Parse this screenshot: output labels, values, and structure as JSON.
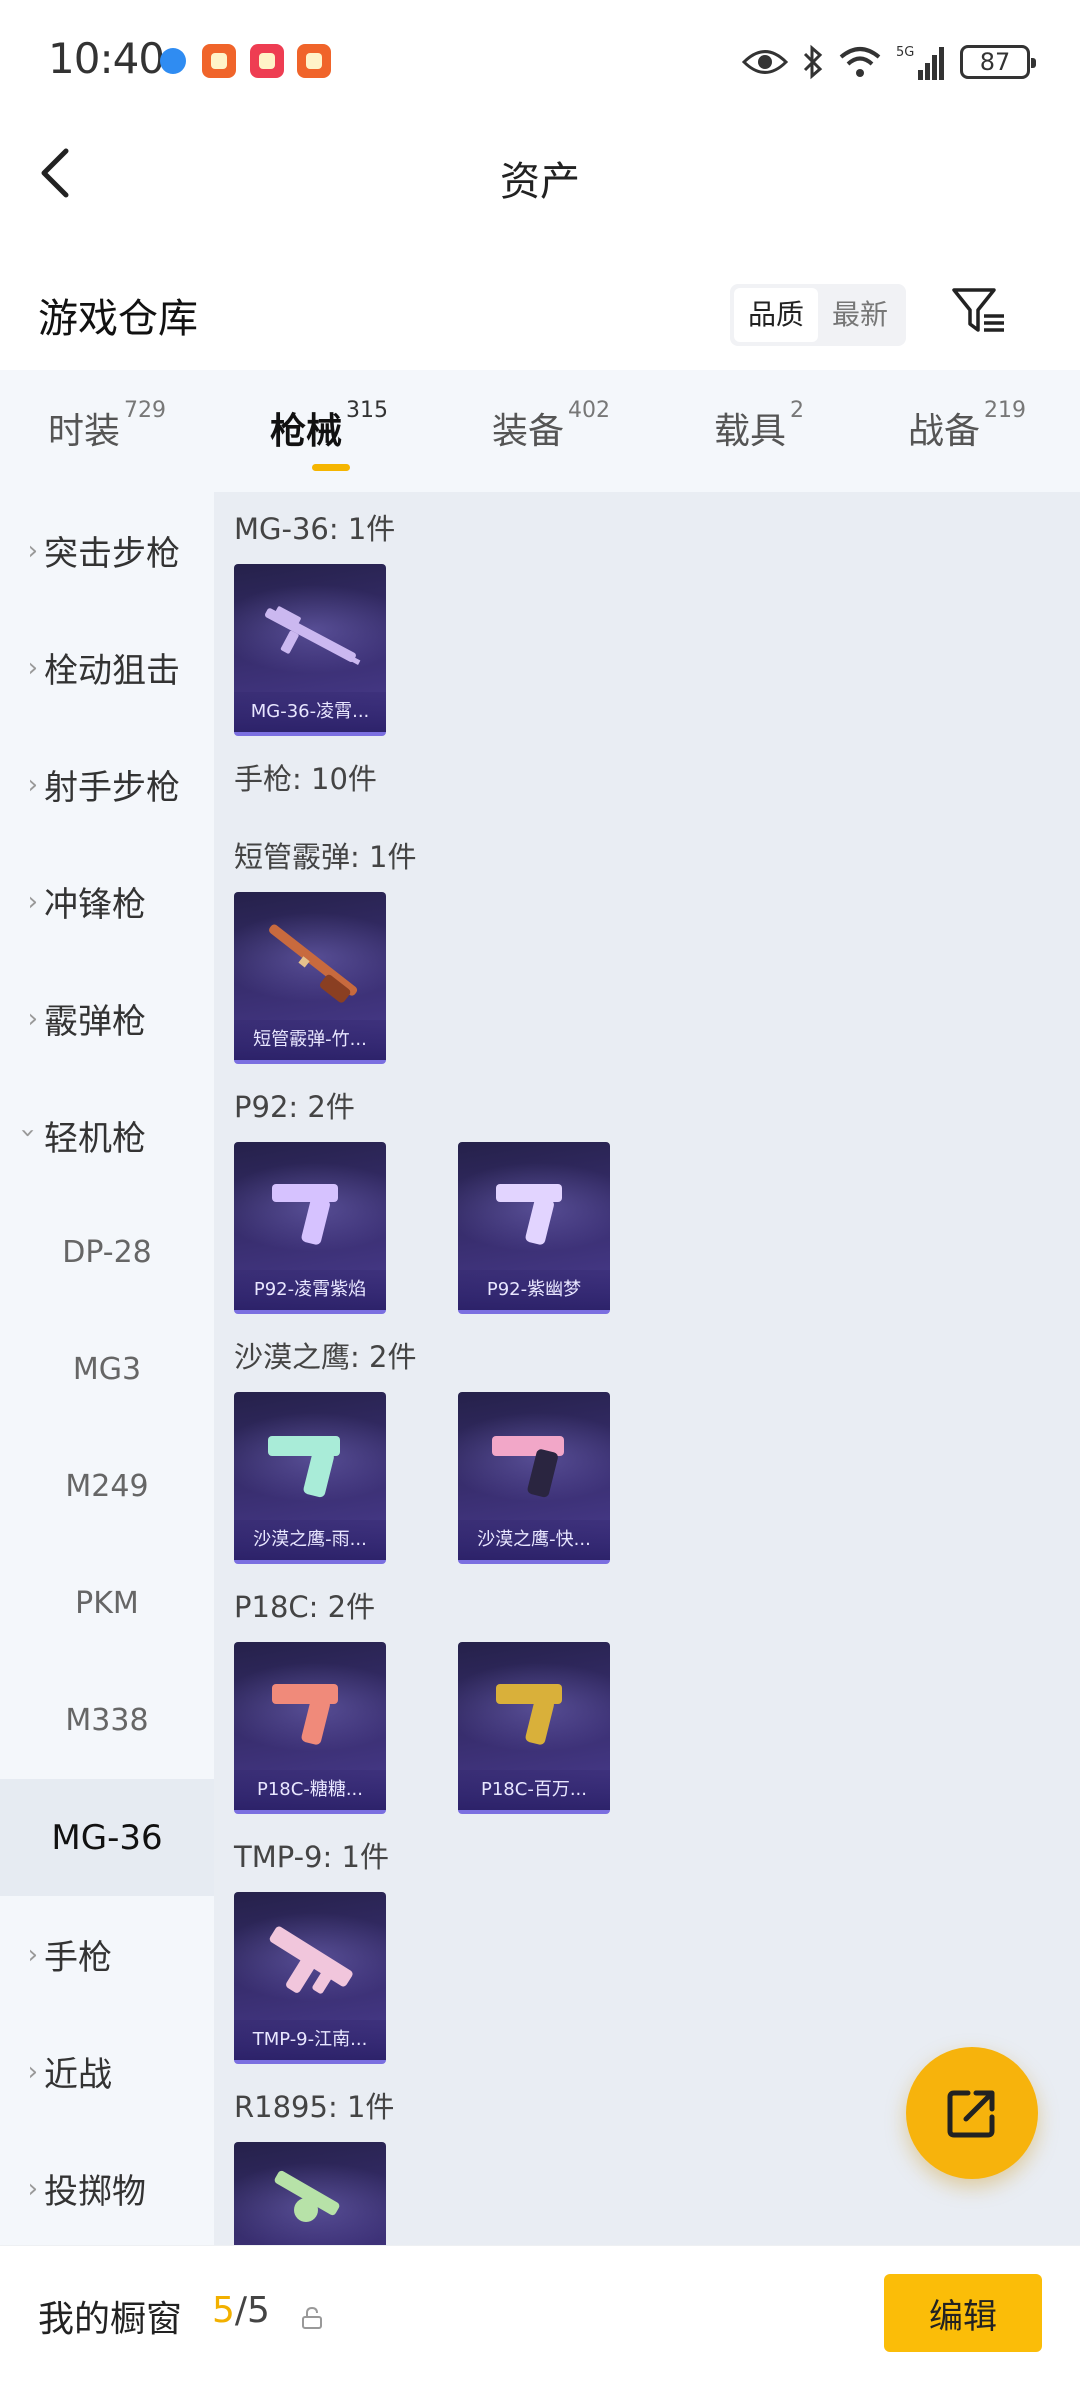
{
  "status_bar": {
    "time": "10:40",
    "battery": "87",
    "network": "5G"
  },
  "nav": {
    "title": "资产"
  },
  "header": {
    "title": "游戏仓库",
    "sort_options": [
      "品质",
      "最新"
    ],
    "active_sort": "品质"
  },
  "tabs": [
    {
      "label": "时装",
      "count": "729"
    },
    {
      "label": "枪械",
      "count": "315",
      "active": true
    },
    {
      "label": "装备",
      "count": "402"
    },
    {
      "label": "载具",
      "count": "2"
    },
    {
      "label": "战备",
      "count": "219"
    }
  ],
  "sidebar": {
    "categories": [
      "突击步枪",
      "栓动狙击",
      "射手步枪",
      "冲锋枪",
      "霰弹枪",
      "轻机枪"
    ],
    "expanded": "轻机枪",
    "subs": [
      "DP-28",
      "MG3",
      "M249",
      "PKM",
      "M338",
      "MG-36"
    ],
    "selected_sub": "MG-36",
    "after": [
      "手枪",
      "近战",
      "投掷物"
    ]
  },
  "content": {
    "groups": [
      {
        "title": "MG-36: 1件",
        "items": [
          "MG-36-凌霄..."
        ]
      },
      {
        "title": "手枪: 10件",
        "items": []
      },
      {
        "title": "短管霰弹: 1件",
        "items": [
          "短管霰弹-竹..."
        ]
      },
      {
        "title": "P92: 2件",
        "items": [
          "P92-凌霄紫焰",
          "P92-紫幽梦"
        ]
      },
      {
        "title": "沙漠之鹰: 2件",
        "items": [
          "沙漠之鹰-雨...",
          "沙漠之鹰-快..."
        ]
      },
      {
        "title": "P18C: 2件",
        "items": [
          "P18C-糖糖...",
          "P18C-百万..."
        ]
      },
      {
        "title": "TMP-9: 1件",
        "items": [
          "TMP-9-江南..."
        ]
      },
      {
        "title": "R1895: 1件",
        "items": []
      }
    ]
  },
  "bottom": {
    "label": "我的橱窗",
    "count_current": "5",
    "count_total": "/5",
    "edit": "编辑"
  },
  "colors": {
    "accent": "#f5b500",
    "card_bg": "#3a2f72",
    "content_bg": "#e9edf3",
    "sidebar_bg": "#f4f7fb"
  }
}
